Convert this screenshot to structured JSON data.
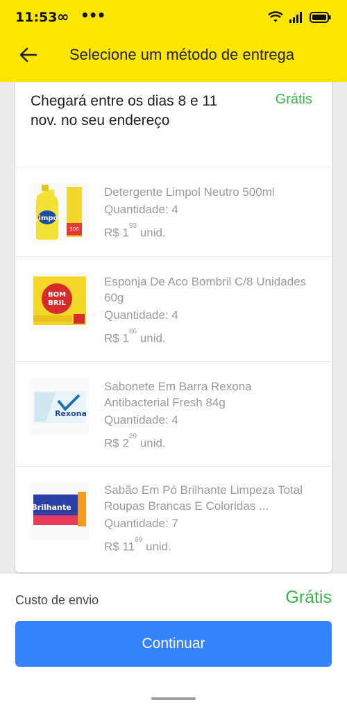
{
  "status_bar": {
    "time": "11:53",
    "loop_glyph": "∞",
    "more_glyph": "•••",
    "icons": [
      "wifi-icon",
      "signal-icon",
      "battery-icon"
    ]
  },
  "header": {
    "title": "Selecione um método de entrega",
    "back_icon": "arrow-left-icon",
    "background": "#ffe600"
  },
  "shipment": {
    "arrival_text": "Chegará entre os dias 8 e 11 nov. no seu endereço",
    "cost_label": "Grátis"
  },
  "items": [
    {
      "name": "Detergente Limpol Neutro 500ml",
      "quantity": "Quantidade: 4",
      "currency": "R$ 1",
      "cents": "93",
      "unit": "unid.",
      "image": "limpol-detergent-bottle"
    },
    {
      "name": "Esponja De Aco Bombril C/8 Unidades 60g",
      "quantity": "Quantidade: 4",
      "currency": "R$ 1",
      "cents": "86",
      "unit": "unid.",
      "image": "bombril-steel-wool-pack"
    },
    {
      "name": "Sabonete Em Barra Rexona Antibacterial Fresh 84g",
      "quantity": "Quantidade: 4",
      "currency": "R$ 2",
      "cents": "29",
      "unit": "unid.",
      "image": "rexona-soap-bar"
    },
    {
      "name": "Sabão Em Pó Brilhante Limpeza Total Roupas Brancas E Coloridas ...",
      "quantity": "Quantidade: 7",
      "currency": "R$ 11",
      "cents": "69",
      "unit": "unid.",
      "image": "brilhante-detergent-box"
    }
  ],
  "footer": {
    "shipping_label": "Custo de envio",
    "shipping_value": "Grátis",
    "continue_label": "Continuar"
  },
  "colors": {
    "accent_yellow": "#ffe600",
    "button_blue": "#3483fa",
    "free_green": "#39b54a"
  }
}
